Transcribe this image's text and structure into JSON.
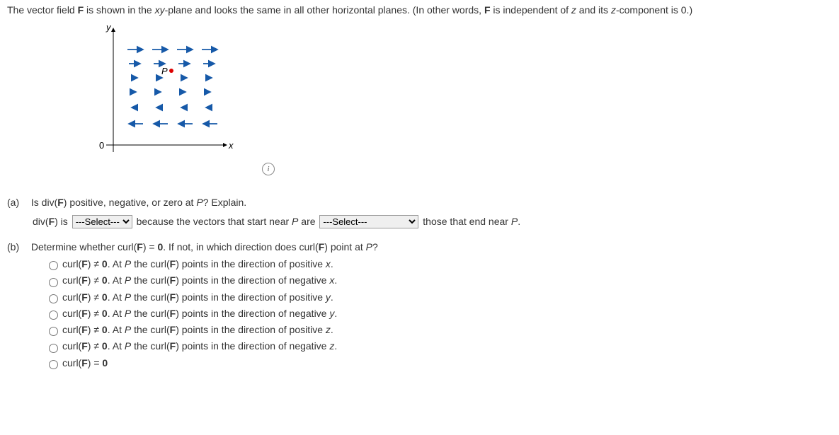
{
  "intro": {
    "pre": "The vector field ",
    "F": "F",
    "mid1": " is shown in the ",
    "xy": "xy",
    "mid2": "-plane and looks the same in all other horizontal planes. (In other words, ",
    "F2": "F",
    "mid3": " is independent of ",
    "z": "z",
    "mid4": " and its ",
    "z2": "z",
    "mid5": "-component is 0.)"
  },
  "figure": {
    "y_label": "y",
    "x_label": "x",
    "origin_label": "0",
    "P_label": "P"
  },
  "partA": {
    "label": "(a)",
    "question_pre": "Is div(",
    "F": "F",
    "question_post": ") positive, negative, or zero at ",
    "P": "P",
    "question_end": "? Explain.",
    "answer_pre": "div(",
    "answer_F": "F",
    "answer_mid1": ") is ",
    "select1_default": "---Select---",
    "answer_mid2": " because the vectors that start near ",
    "answer_P": "P",
    "answer_mid3": " are ",
    "select2_default": "---Select---",
    "answer_end": " those that end near ",
    "answer_P2": "P",
    "answer_period": "."
  },
  "partB": {
    "label": "(b)",
    "question_pre": "Determine whether curl(",
    "F": "F",
    "question_mid1": ") = ",
    "zero": "0",
    "question_mid2": ". If not, in which direction does curl(",
    "F2": "F",
    "question_mid3": ") point at ",
    "P": "P",
    "question_end": "?",
    "options": [
      {
        "pre": "curl(",
        "F": "F",
        "mid1": ") ≠ ",
        "zero": "0",
        "mid2": ". At ",
        "P": "P",
        "mid3": " the curl(",
        "F2": "F",
        "mid4": ") points in the direction of positive ",
        "axis": "x",
        "end": "."
      },
      {
        "pre": "curl(",
        "F": "F",
        "mid1": ") ≠ ",
        "zero": "0",
        "mid2": ". At ",
        "P": "P",
        "mid3": " the curl(",
        "F2": "F",
        "mid4": ") points in the direction of negative ",
        "axis": "x",
        "end": "."
      },
      {
        "pre": "curl(",
        "F": "F",
        "mid1": ") ≠ ",
        "zero": "0",
        "mid2": ". At ",
        "P": "P",
        "mid3": " the curl(",
        "F2": "F",
        "mid4": ") points in the direction of positive ",
        "axis": "y",
        "end": "."
      },
      {
        "pre": "curl(",
        "F": "F",
        "mid1": ") ≠ ",
        "zero": "0",
        "mid2": ". At ",
        "P": "P",
        "mid3": " the curl(",
        "F2": "F",
        "mid4": ") points in the direction of negative ",
        "axis": "y",
        "end": "."
      },
      {
        "pre": "curl(",
        "F": "F",
        "mid1": ") ≠ ",
        "zero": "0",
        "mid2": ". At ",
        "P": "P",
        "mid3": " the curl(",
        "F2": "F",
        "mid4": ") points in the direction of positive ",
        "axis": "z",
        "end": "."
      },
      {
        "pre": "curl(",
        "F": "F",
        "mid1": ") ≠ ",
        "zero": "0",
        "mid2": ". At ",
        "P": "P",
        "mid3": " the curl(",
        "F2": "F",
        "mid4": ") points in the direction of negative ",
        "axis": "z",
        "end": "."
      },
      {
        "pre": "curl(",
        "F": "F",
        "mid1": ") = ",
        "zero": "0",
        "mid2": "",
        "P": "",
        "mid3": "",
        "F2": "",
        "mid4": "",
        "axis": "",
        "end": ""
      }
    ]
  }
}
